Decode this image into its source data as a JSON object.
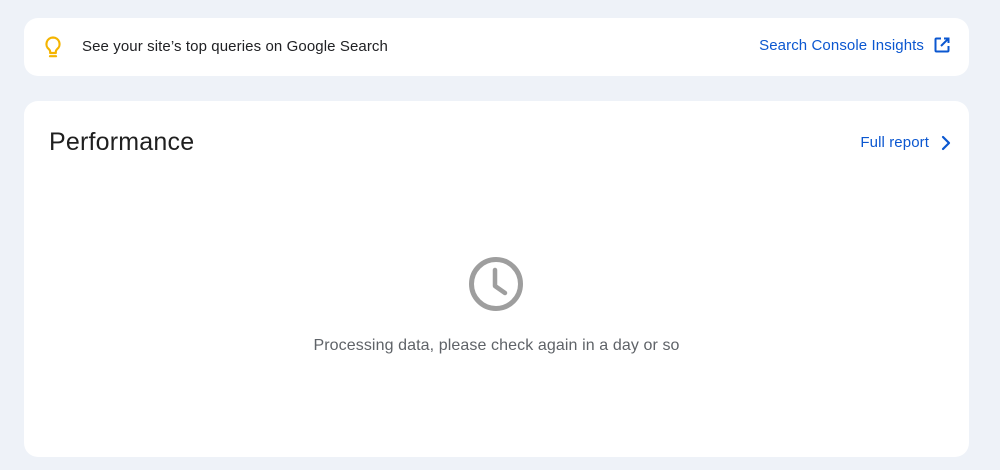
{
  "banner": {
    "text": "See your site’s top queries on Google Search",
    "link_label": "Search Console Insights",
    "icon": "lightbulb-icon",
    "link_icon": "open-in-new-icon"
  },
  "performance": {
    "title": "Performance",
    "full_report_label": "Full report",
    "full_report_icon": "chevron-right-icon",
    "status_icon": "clock-icon",
    "status_message": "Processing data, please check again in a day or so"
  },
  "colors": {
    "background": "#eef2f8",
    "card": "#ffffff",
    "link": "#0b57d0",
    "bulb": "#f4b400",
    "clock": "#9e9e9e",
    "muted_text": "#5f6368"
  }
}
